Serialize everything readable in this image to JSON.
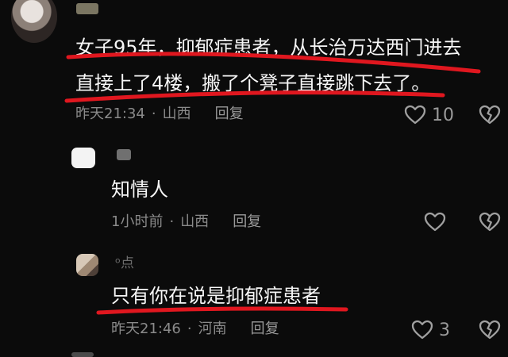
{
  "comments": [
    {
      "line1": "女子95年，抑郁症患者，从长治万达西门进去",
      "line2": "直接上了4楼，搬了个凳子直接跳下去了。",
      "time": "昨天21:34",
      "location": "山西",
      "reply_label": "回复",
      "likes": "10",
      "like_icon": "heart-outline-icon",
      "dislike_icon": "broken-heart-icon"
    },
    {
      "text": "知情人",
      "time": "1小时前",
      "location": "山西",
      "reply_label": "回复",
      "likes": "",
      "like_icon": "heart-outline-icon",
      "dislike_icon": "broken-heart-icon"
    },
    {
      "username_partial": "ᵒ点",
      "text": "只有你在说是抑郁症患者",
      "time": "昨天21:46",
      "location": "河南",
      "reply_label": "回复",
      "likes": "3",
      "like_icon": "heart-outline-icon",
      "dislike_icon": "broken-heart-icon"
    }
  ],
  "theme": {
    "background": "#0b0b0b",
    "text": "#f6f6f6",
    "meta_text": "#8a8a8a",
    "annotation_red": "#e0171f"
  }
}
